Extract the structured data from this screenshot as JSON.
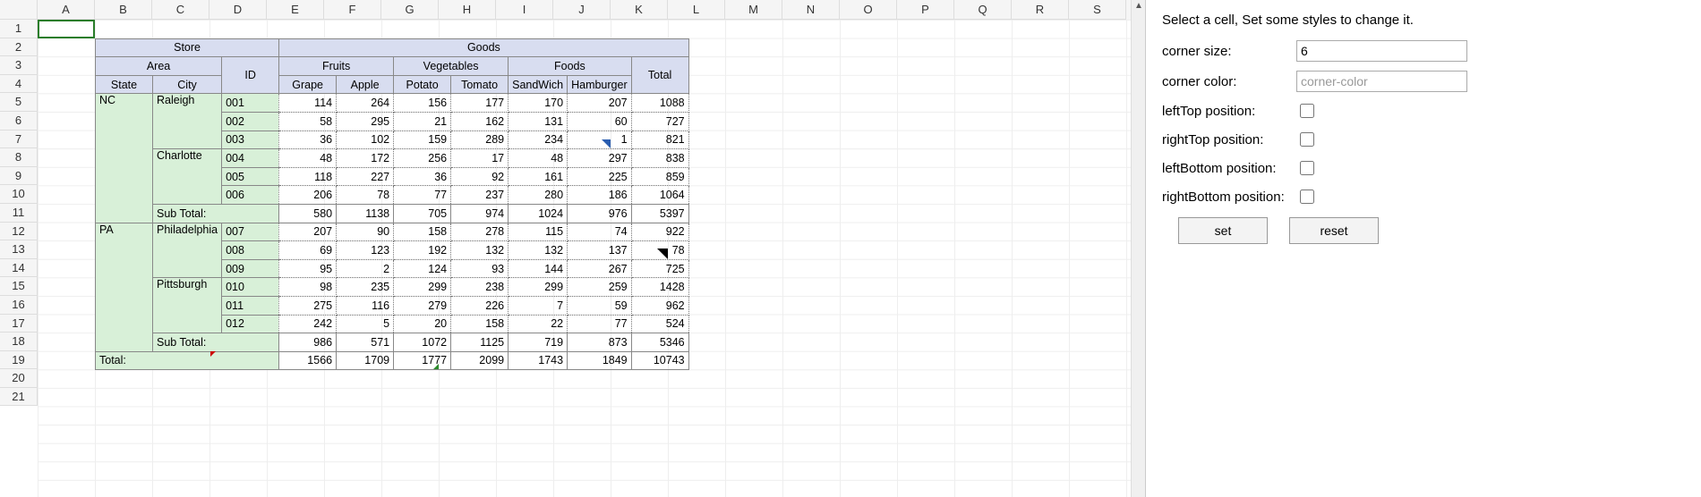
{
  "columns": [
    "A",
    "B",
    "C",
    "D",
    "E",
    "F",
    "G",
    "H",
    "I",
    "J",
    "K",
    "L",
    "M",
    "N",
    "O",
    "P",
    "Q",
    "R",
    "S"
  ],
  "row_count": 21,
  "headers": {
    "store": "Store",
    "goods": "Goods",
    "area": "Area",
    "id": "ID",
    "fruits": "Fruits",
    "vegetables": "Vegetables",
    "foods": "Foods",
    "total": "Total",
    "state": "State",
    "city": "City",
    "cols": [
      "Grape",
      "Apple",
      "Potato",
      "Tomato",
      "SandWich",
      "Hamburger"
    ]
  },
  "sections": [
    {
      "state": "NC",
      "cities": [
        {
          "city": "Raleigh",
          "rows": [
            {
              "id": "001",
              "v": [
                114,
                264,
                156,
                177,
                170,
                207
              ],
              "t": 1088
            },
            {
              "id": "002",
              "v": [
                58,
                295,
                21,
                162,
                131,
                60
              ],
              "t": 727
            },
            {
              "id": "003",
              "v": [
                36,
                102,
                159,
                289,
                234,
                1
              ],
              "t": 821
            }
          ]
        },
        {
          "city": "Charlotte",
          "rows": [
            {
              "id": "004",
              "v": [
                48,
                172,
                256,
                17,
                48,
                297
              ],
              "t": 838
            },
            {
              "id": "005",
              "v": [
                118,
                227,
                36,
                92,
                161,
                225
              ],
              "t": 859
            },
            {
              "id": "006",
              "v": [
                206,
                78,
                77,
                237,
                280,
                186
              ],
              "t": 1064
            }
          ]
        }
      ],
      "subtotal_label": "Sub Total:",
      "subtotal": [
        580,
        1138,
        705,
        974,
        1024,
        976
      ],
      "subtotal_t": 5397
    },
    {
      "state": "PA",
      "cities": [
        {
          "city": "Philadelphia",
          "rows": [
            {
              "id": "007",
              "v": [
                207,
                90,
                158,
                278,
                115,
                74
              ],
              "t": 922
            },
            {
              "id": "008",
              "v": [
                69,
                123,
                192,
                132,
                132,
                137
              ],
              "t": 78
            },
            {
              "id": "009",
              "v": [
                95,
                2,
                124,
                93,
                144,
                267
              ],
              "t": 725
            }
          ]
        },
        {
          "city": "Pittsburgh",
          "rows": [
            {
              "id": "010",
              "v": [
                98,
                235,
                299,
                238,
                299,
                259
              ],
              "t": 1428
            },
            {
              "id": "011",
              "v": [
                275,
                116,
                279,
                226,
                7,
                59
              ],
              "t": 962
            },
            {
              "id": "012",
              "v": [
                242,
                5,
                20,
                158,
                22,
                77
              ],
              "t": 524
            }
          ]
        }
      ],
      "subtotal_label": "Sub Total:",
      "subtotal": [
        986,
        571,
        1072,
        1125,
        719,
        873
      ],
      "subtotal_t": 5346
    }
  ],
  "grand_total_label": "Total:",
  "grand_total": [
    1566,
    1709,
    1777,
    2099,
    1743,
    1849
  ],
  "grand_total_t": 10743,
  "panel": {
    "intro": "Select a cell, Set some styles to change it.",
    "corner_size_label": "corner size:",
    "corner_size_value": "6",
    "corner_color_label": "corner color:",
    "corner_color_placeholder": "corner-color",
    "lt_label": "leftTop position:",
    "rt_label": "rightTop position:",
    "lb_label": "leftBottom position:",
    "rb_label": "rightBottom position:",
    "set": "set",
    "reset": "reset"
  }
}
